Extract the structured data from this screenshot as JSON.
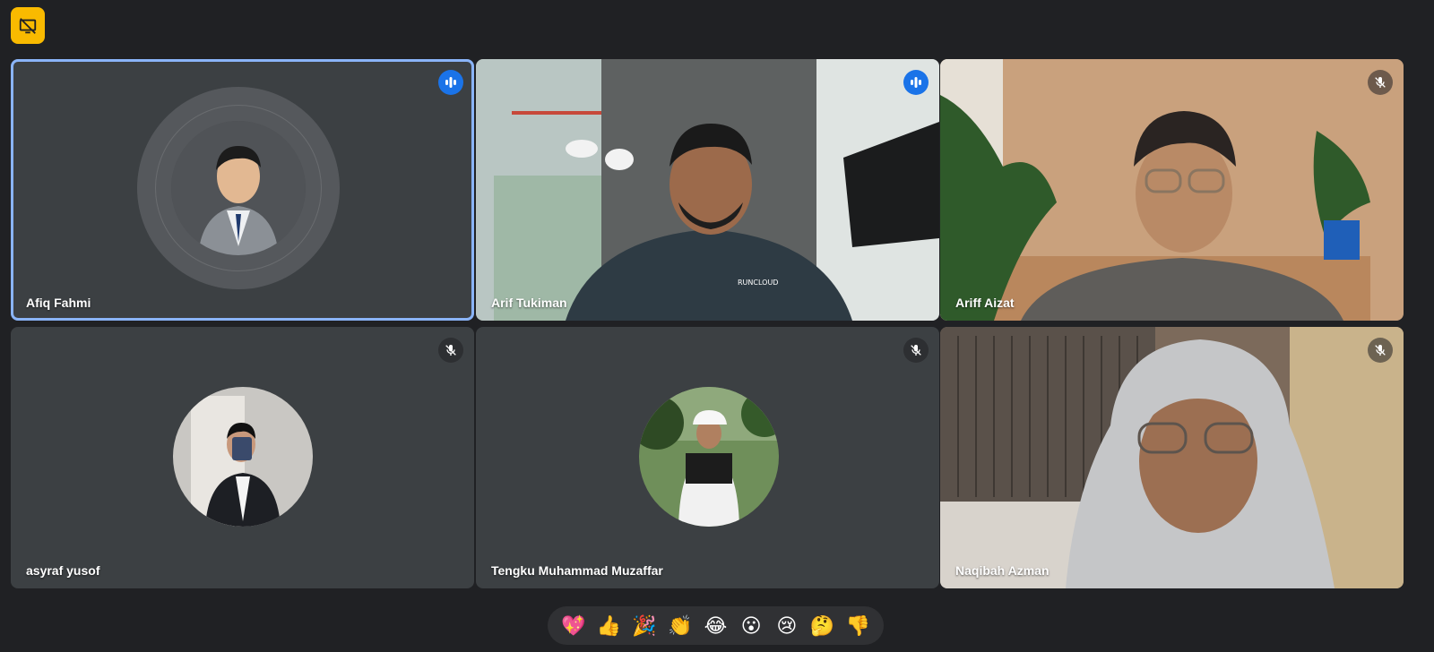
{
  "participants": [
    {
      "name": "Afiq Fahmi",
      "status": "speaking",
      "active": true
    },
    {
      "name": "Arif Tukiman",
      "status": "speaking"
    },
    {
      "name": "Ariff Aizat",
      "status": "muted"
    },
    {
      "name": "asyraf yusof",
      "status": "muted"
    },
    {
      "name": "Tengku Muhammad Muzaffar",
      "status": "muted"
    },
    {
      "name": "Naqibah Azman",
      "status": "muted"
    }
  ],
  "video_text": {
    "shirt_logo": "RUNCLOUD"
  },
  "reactions": [
    {
      "emoji": "💖",
      "icon": "sparkling-heart"
    },
    {
      "emoji": "👍",
      "icon": "thumbs-up"
    },
    {
      "emoji": "🎉",
      "icon": "party-popper"
    },
    {
      "emoji": "👏",
      "icon": "clapping-hands"
    },
    {
      "emoji": "😂",
      "icon": "tears-of-joy"
    },
    {
      "emoji": "😮",
      "icon": "open-mouth"
    },
    {
      "emoji": "😢",
      "icon": "crying-face"
    },
    {
      "emoji": "🤔",
      "icon": "thinking-face"
    },
    {
      "emoji": "👎",
      "icon": "thumbs-down"
    }
  ],
  "colors": {
    "background": "#202124",
    "tile": "#3c4043",
    "speaking": "#1a73e8",
    "active_outline": "#8ab4f8",
    "badge": "#f9ba00"
  }
}
